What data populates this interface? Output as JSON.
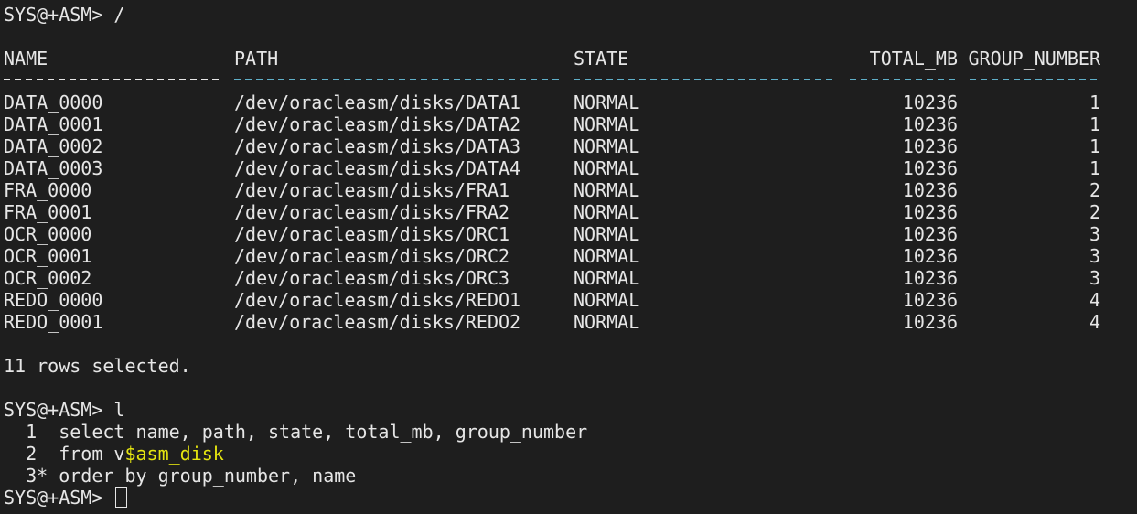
{
  "prompt": "SYS@+ASM>",
  "first_command": "/",
  "columns": {
    "name": "NAME",
    "path": "PATH",
    "state": "STATE",
    "total_mb": "TOTAL_MB",
    "group_number": "GROUP_NUMBER"
  },
  "rows": [
    {
      "name": "DATA_0000",
      "path": "/dev/oracleasm/disks/DATA1",
      "state": "NORMAL",
      "total_mb": "10236",
      "group_number": "1"
    },
    {
      "name": "DATA_0001",
      "path": "/dev/oracleasm/disks/DATA2",
      "state": "NORMAL",
      "total_mb": "10236",
      "group_number": "1"
    },
    {
      "name": "DATA_0002",
      "path": "/dev/oracleasm/disks/DATA3",
      "state": "NORMAL",
      "total_mb": "10236",
      "group_number": "1"
    },
    {
      "name": "DATA_0003",
      "path": "/dev/oracleasm/disks/DATA4",
      "state": "NORMAL",
      "total_mb": "10236",
      "group_number": "1"
    },
    {
      "name": "FRA_0000",
      "path": "/dev/oracleasm/disks/FRA1",
      "state": "NORMAL",
      "total_mb": "10236",
      "group_number": "2"
    },
    {
      "name": "FRA_0001",
      "path": "/dev/oracleasm/disks/FRA2",
      "state": "NORMAL",
      "total_mb": "10236",
      "group_number": "2"
    },
    {
      "name": "OCR_0000",
      "path": "/dev/oracleasm/disks/ORC1",
      "state": "NORMAL",
      "total_mb": "10236",
      "group_number": "3"
    },
    {
      "name": "OCR_0001",
      "path": "/dev/oracleasm/disks/ORC2",
      "state": "NORMAL",
      "total_mb": "10236",
      "group_number": "3"
    },
    {
      "name": "OCR_0002",
      "path": "/dev/oracleasm/disks/ORC3",
      "state": "NORMAL",
      "total_mb": "10236",
      "group_number": "3"
    },
    {
      "name": "REDO_0000",
      "path": "/dev/oracleasm/disks/REDO1",
      "state": "NORMAL",
      "total_mb": "10236",
      "group_number": "4"
    },
    {
      "name": "REDO_0001",
      "path": "/dev/oracleasm/disks/REDO2",
      "state": "NORMAL",
      "total_mb": "10236",
      "group_number": "4"
    }
  ],
  "rows_selected": "11 rows selected.",
  "second_command": "l",
  "sql_lines": [
    {
      "num": "  1 ",
      "pre": " select name, path, state, total_mb, group_number",
      "hl": "",
      "post": ""
    },
    {
      "num": "  2 ",
      "pre": " from v",
      "hl": "$asm_disk",
      "post": ""
    },
    {
      "num": "  3*",
      "pre": " order by group_number, name",
      "hl": "",
      "post": ""
    }
  ],
  "colors": {
    "background": "#1e1e1e",
    "text": "#e6e6e6",
    "separator_cyan": "#5fb0c9",
    "highlight_yellow": "#e5e510"
  }
}
